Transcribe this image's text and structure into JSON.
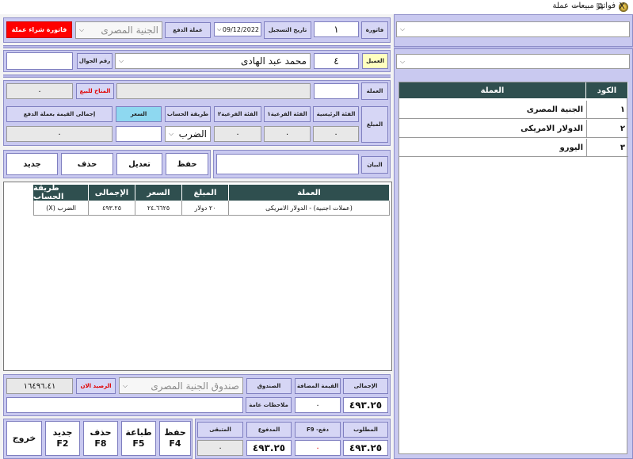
{
  "window": {
    "title": "فواتير مبيعات عملة",
    "minimize": "—",
    "restore": "⧉",
    "close": "X"
  },
  "header": {
    "invoice_label": "فاتورة",
    "invoice_no": "١",
    "reg_date_label": "تاريخ التسجيل",
    "reg_date": "09/12/2022",
    "pay_currency_label": "عملة الدفع",
    "pay_currency": "الجنية المصرى",
    "buy_invoice_btn": "فاتورة شراء عملة"
  },
  "client": {
    "label": "العميل",
    "code": "٤",
    "name": "محمد عبد الهادى",
    "mobile_label": "رقم الجوال",
    "mobile": ""
  },
  "item": {
    "currency_label": "العملة",
    "currency_value": "",
    "available_label": "المتاح للبيع",
    "available_value": "٠",
    "amount_label": "المبلغ",
    "main_label": "الفئة الرئيسية",
    "sub1_label": "الفئة الفرعية١",
    "sub2_label": "الفئة الفرعية٢",
    "calc_label": "طريقة الحساب",
    "price_label": "السعر",
    "total_label": "إجمالى القيمة بعملة الدفع",
    "main_value": "٠",
    "sub1_value": "٠",
    "sub2_value": "٠",
    "calc_value": "الضرب",
    "price_value": "",
    "total_value": "٠"
  },
  "statement": {
    "label": "البيان",
    "value": ""
  },
  "actions": {
    "save": "حفظ",
    "edit": "تعديل",
    "delete": "حذف",
    "new": "جديد"
  },
  "table": {
    "headers": [
      "العملة",
      "المبلغ",
      "السعر",
      "الإجمالى",
      "طريقة الحساب"
    ],
    "rows": [
      [
        "(عملات اجنبية) - الدولار الامريكى",
        "٢٠ دولار",
        "٢٤.٦٦٢٥",
        "٤٩٣.٢٥",
        "الضرب (X)"
      ]
    ]
  },
  "totals": {
    "total_label": "الإجمالى",
    "total_value": "٤٩٣.٢٥",
    "vat_label": "القيمة المضافة",
    "vat_value": "٠",
    "box_label": "الصندوق",
    "box_value": "صندوق الجنية المصرى",
    "balance_label": "الرصيد الان",
    "balance_value": "١٦٤٩٦.٤١",
    "notes_label": "ملاحظات عامة",
    "notes_value": ""
  },
  "payment": {
    "required_label": "المطلوب",
    "required_value": "٤٩٣.٢٥",
    "pay_label": "دفع- F9",
    "pay_value": "٠",
    "paid_label": "المدفوع",
    "paid_value": "٤٩٣.٢٥",
    "remaining_label": "المتبقى",
    "remaining_value": "٠"
  },
  "bottom_buttons": {
    "save": "حفظ",
    "save_key": "F4",
    "print": "طباعة",
    "print_key": "F5",
    "delete": "حذف",
    "delete_key": "F8",
    "new": "جديد",
    "new_key": "F2",
    "exit": "خروج"
  },
  "right_panel": {
    "headers": [
      "الكود",
      "العملة"
    ],
    "rows": [
      [
        "١",
        "الجنية المصرى"
      ],
      [
        "٢",
        "الدولار الامريكى"
      ],
      [
        "٣",
        "اليورو"
      ]
    ]
  },
  "colors": {
    "panel": "#c9c9f0",
    "grid_header": "#2f4f4f",
    "red": "#ff0000",
    "cyan": "#8ed8f0",
    "yellow": "#ffffc0"
  }
}
